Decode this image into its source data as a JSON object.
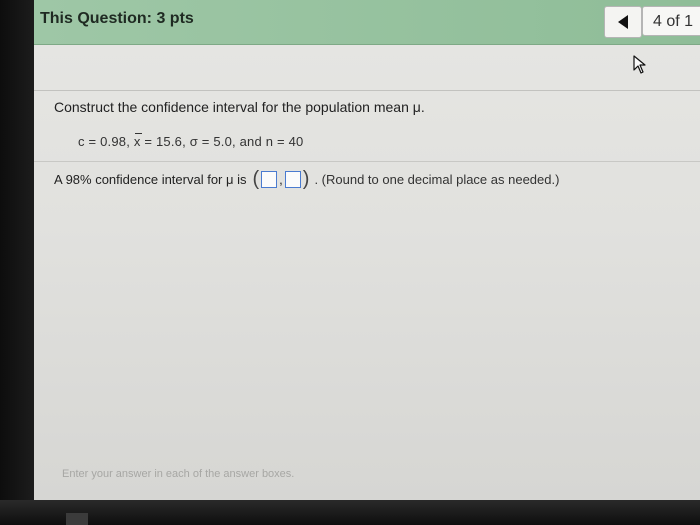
{
  "header": {
    "title": "This Question: 3 pts",
    "page_counter": "4 of 1"
  },
  "question": {
    "prompt": "Construct the confidence interval for the population mean μ.",
    "given": {
      "c": "c = 0.98,",
      "xbar_symbol": "x",
      "xbar_rest": " = 15.6,  σ = 5.0,  and n = 40"
    },
    "answer": {
      "prefix": "A 98% confidence interval for μ is",
      "open_paren": "(",
      "comma": ",",
      "close_paren": ")",
      "lower_value": "",
      "upper_value": "",
      "note": ". (Round to one decimal place as needed.)"
    }
  },
  "footer": {
    "hint": "Enter your answer in each of the answer boxes."
  },
  "icons": {
    "prev": "left-triangle-icon",
    "cursor": "mouse-pointer-icon"
  }
}
